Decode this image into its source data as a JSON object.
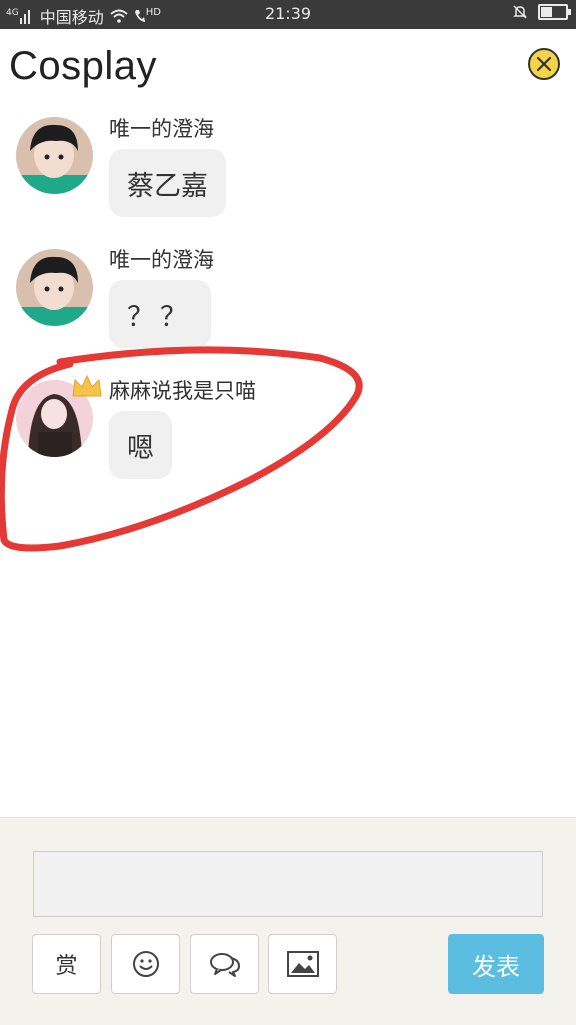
{
  "status_bar": {
    "signal_tag": "4G",
    "carrier": "中国移动",
    "call_tag": "HD",
    "time": "21:39",
    "battery_level": 0.5
  },
  "header": {
    "title": "Cosplay"
  },
  "messages": [
    {
      "author": "唯一的澄海",
      "text": "蔡乙嘉"
    },
    {
      "author": "唯一的澄海",
      "text": "？？"
    },
    {
      "author": "麻麻说我是只喵",
      "text": "嗯"
    }
  ],
  "composer": {
    "reward_label": "赏",
    "send_label": "发表",
    "input_value": ""
  },
  "colors": {
    "annotation": "#e53935",
    "send_button": "#5bbde0",
    "close_button": "#f5d447",
    "bubble": "#f0f0f0",
    "composer_bg": "#f3f2ec"
  },
  "icons": [
    "signal-icon",
    "wifi-icon",
    "phone-hd-icon",
    "mute-icon",
    "battery-icon",
    "close-icon",
    "crown-icon",
    "smiley-icon",
    "chat-bubbles-icon",
    "image-icon"
  ]
}
